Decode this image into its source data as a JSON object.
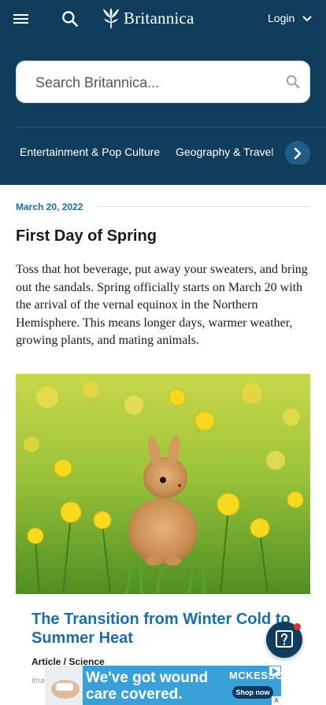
{
  "header": {
    "logo_text": "Britannica",
    "login_label": "Login"
  },
  "search": {
    "placeholder": "Search Britannica..."
  },
  "categories": [
    {
      "label": "Entertainment & Pop Culture"
    },
    {
      "label": "Geography & Travel"
    }
  ],
  "article": {
    "date": "March 20, 2022",
    "title": "First Day of Spring",
    "body": "Toss that hot beverage, put away your sweaters, and bring out the sandals. Spring officially starts on March 20 with the arrival of the vernal equinox in the Northern Hemisphere. This means longer days, warmer weather, growing plants, and mating animals."
  },
  "card": {
    "title": "The Transition from Winter Cold to Summer Heat",
    "meta": "Article / Science",
    "credit": "Ima"
  },
  "ad": {
    "line1": "We've got wound",
    "line2": "care covered.",
    "brand": "MCKESSON",
    "cta": "Shop now"
  },
  "colors": {
    "header_bg": "#0f3d5b",
    "link_blue": "#1a6ea6",
    "help_dot": "#d8332c"
  }
}
